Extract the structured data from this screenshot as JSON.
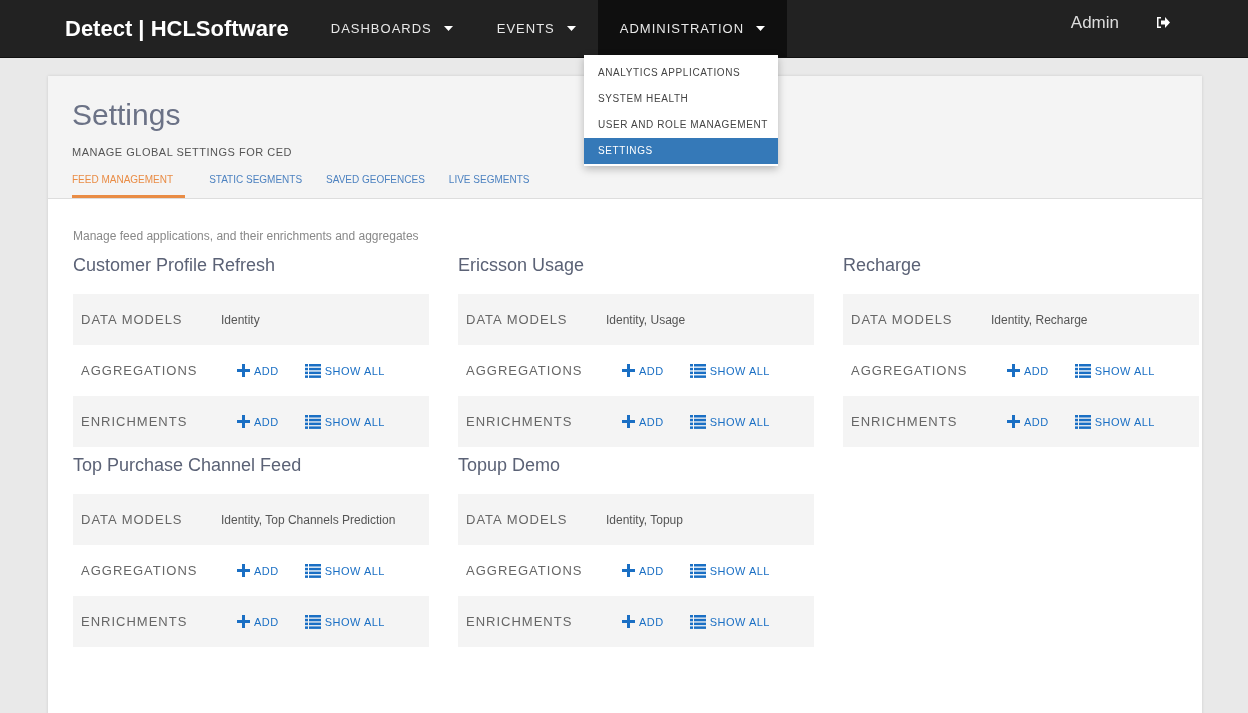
{
  "navbar": {
    "brand": "Detect | HCLSoftware",
    "menus": [
      {
        "label": "DASHBOARDS",
        "selected": false
      },
      {
        "label": "EVENTS",
        "selected": false
      },
      {
        "label": "ADMINISTRATION",
        "selected": true
      }
    ],
    "dropdown": [
      {
        "label": "ANALYTICS APPLICATIONS",
        "selected": false
      },
      {
        "label": "SYSTEM HEALTH",
        "selected": false
      },
      {
        "label": "USER AND ROLE MANAGEMENT",
        "selected": false
      },
      {
        "label": "SETTINGS",
        "selected": true
      }
    ],
    "user": "Admin"
  },
  "page": {
    "title": "Settings",
    "subtitle": "MANAGE GLOBAL SETTINGS FOR CED",
    "tabs": [
      {
        "label": "FEED MANAGEMENT",
        "selected": true
      },
      {
        "label": "STATIC SEGMENTS",
        "selected": false
      },
      {
        "label": "SAVED GEOFENCES",
        "selected": false
      },
      {
        "label": "LIVE SEGMENTS",
        "selected": false
      }
    ],
    "description": "Manage feed applications, and their enrichments and aggregates",
    "feeds": [
      {
        "name": "Customer Profile Refresh",
        "rows": [
          {
            "kind": "text",
            "label": "DATA MODELS",
            "value": "Identity"
          },
          {
            "kind": "actions",
            "label": "AGGREGATIONS",
            "add": "ADD",
            "show_all": "SHOW ALL"
          },
          {
            "kind": "actions",
            "label": "ENRICHMENTS",
            "add": "ADD",
            "show_all": "SHOW ALL"
          }
        ]
      },
      {
        "name": "Ericsson Usage",
        "rows": [
          {
            "kind": "text",
            "label": "DATA MODELS",
            "value": "Identity, Usage"
          },
          {
            "kind": "actions",
            "label": "AGGREGATIONS",
            "add": "ADD",
            "show_all": "SHOW ALL"
          },
          {
            "kind": "actions",
            "label": "ENRICHMENTS",
            "add": "ADD",
            "show_all": "SHOW ALL"
          }
        ]
      },
      {
        "name": "Recharge",
        "rows": [
          {
            "kind": "text",
            "label": "DATA MODELS",
            "value": "Identity, Recharge"
          },
          {
            "kind": "actions",
            "label": "AGGREGATIONS",
            "add": "ADD",
            "show_all": "SHOW ALL"
          },
          {
            "kind": "actions",
            "label": "ENRICHMENTS",
            "add": "ADD",
            "show_all": "SHOW ALL"
          }
        ]
      },
      {
        "name": "Top Purchase Channel Feed",
        "rows": [
          {
            "kind": "text",
            "label": "DATA MODELS",
            "value": "Identity, Top Channels Prediction"
          },
          {
            "kind": "actions",
            "label": "AGGREGATIONS",
            "add": "ADD",
            "show_all": "SHOW ALL"
          },
          {
            "kind": "actions",
            "label": "ENRICHMENTS",
            "add": "ADD",
            "show_all": "SHOW ALL"
          }
        ]
      },
      {
        "name": "Topup Demo",
        "rows": [
          {
            "kind": "text",
            "label": "DATA MODELS",
            "value": "Identity, Topup"
          },
          {
            "kind": "actions",
            "label": "AGGREGATIONS",
            "add": "ADD",
            "show_all": "SHOW ALL"
          },
          {
            "kind": "actions",
            "label": "ENRICHMENTS",
            "add": "ADD",
            "show_all": "SHOW ALL"
          }
        ]
      }
    ]
  }
}
